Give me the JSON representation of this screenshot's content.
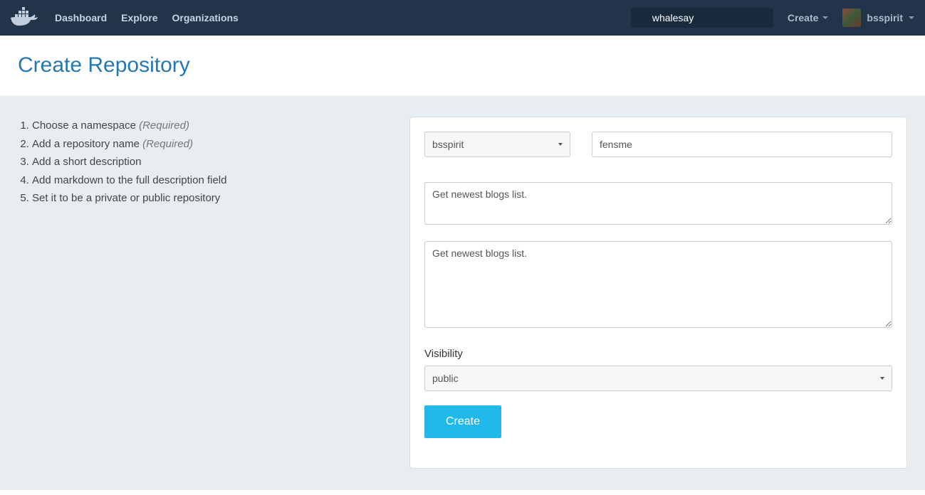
{
  "nav": {
    "dashboard": "Dashboard",
    "explore": "Explore",
    "organizations": "Organizations",
    "search_value": "whalesay",
    "create_label": "Create",
    "username": "bsspirit"
  },
  "header": {
    "title": "Create Repository"
  },
  "instructions": {
    "step1_text": "Choose a namespace ",
    "step1_req": "(Required)",
    "step2_text": "Add a repository name ",
    "step2_req": "(Required)",
    "step3_text": "Add a short description",
    "step4_text": "Add markdown to the full description field",
    "step5_text": "Set it to be a private or public repository"
  },
  "form": {
    "namespace_value": "bsspirit",
    "repo_name_value": "fensme",
    "short_desc_value": "Get newest blogs list.",
    "full_desc_value": "Get newest blogs list.",
    "visibility_label": "Visibility",
    "visibility_value": "public",
    "create_button": "Create"
  }
}
